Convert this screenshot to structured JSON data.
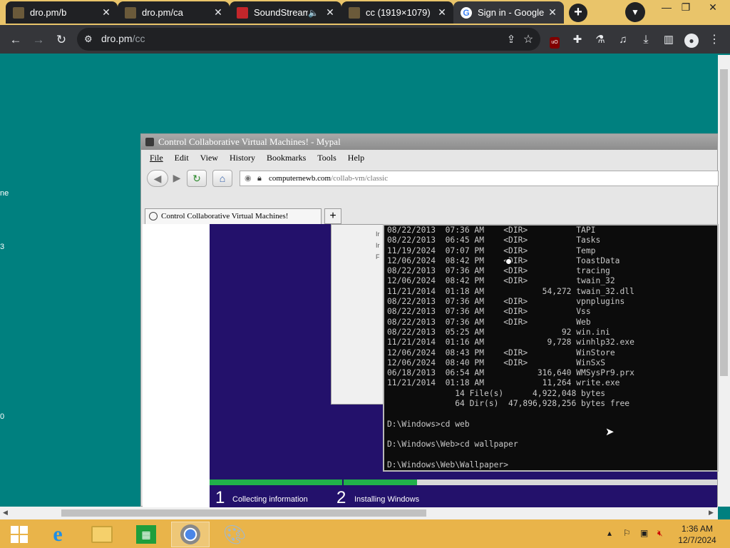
{
  "browser": {
    "tabs": [
      {
        "title": "dro.pm/b",
        "favicon_color": "#6b5a3a"
      },
      {
        "title": "dro.pm/ca",
        "favicon_color": "#6b5a3a"
      },
      {
        "title": "SoundStream",
        "favicon_color": "#c3262b"
      },
      {
        "title": "cc (1919×1079)",
        "favicon_color": "#6b5a3a"
      },
      {
        "title": "Sign in - Google",
        "favicon_color": "#4285f4"
      }
    ],
    "address": {
      "host": "dro.pm",
      "path": "/cc"
    },
    "accent": "#e9c46a"
  },
  "page": {
    "side_labels": [
      "ne",
      "3",
      "0"
    ]
  },
  "vm": {
    "title": "Control Collaborative Virtual Machines! - Mypal",
    "menu": [
      "File",
      "Edit",
      "View",
      "History",
      "Bookmarks",
      "Tools",
      "Help"
    ],
    "url": {
      "host": "computernewb.com",
      "path": "/collab-vm/classic"
    },
    "tab_title": "Control Collaborative Virtual Machines!",
    "dialog_fragments": [
      "Ir",
      "Ir",
      "F"
    ],
    "cmd_lines": [
      "08/22/2013  07:36 AM    <DIR>          TAPI",
      "08/22/2013  06:45 AM    <DIR>          Tasks",
      "11/19/2024  07:07 PM    <DIR>          Temp",
      "12/06/2024  08:42 PM    <DIR>          ToastData",
      "08/22/2013  07:36 AM    <DIR>          tracing",
      "12/06/2024  08:42 PM    <DIR>          twain_32",
      "11/21/2014  01:18 AM            54,272 twain_32.dll",
      "08/22/2013  07:36 AM    <DIR>          vpnplugins",
      "08/22/2013  07:36 AM    <DIR>          Vss",
      "08/22/2013  07:36 AM    <DIR>          Web",
      "08/22/2013  05:25 AM                92 win.ini",
      "11/21/2014  01:16 AM             9,728 winhlp32.exe",
      "12/06/2024  08:43 PM    <DIR>          WinStore",
      "12/06/2024  08:40 PM    <DIR>          WinSxS",
      "06/18/2013  06:54 AM           316,640 WMSysPr9.prx",
      "11/21/2014  01:18 AM            11,264 write.exe",
      "              14 File(s)      4,922,048 bytes",
      "              64 Dir(s)  47,896,928,256 bytes free",
      "",
      "D:\\Windows>cd web",
      "",
      "D:\\Windows\\Web>cd wallpaper",
      "",
      "D:\\Windows\\Web\\Wallpaper>"
    ],
    "setup_steps": [
      {
        "num": "1",
        "label": "Collecting information"
      },
      {
        "num": "2",
        "label": "Installing Windows"
      }
    ]
  },
  "taskbar": {
    "time": "1:36 AM",
    "date": "12/7/2024"
  }
}
